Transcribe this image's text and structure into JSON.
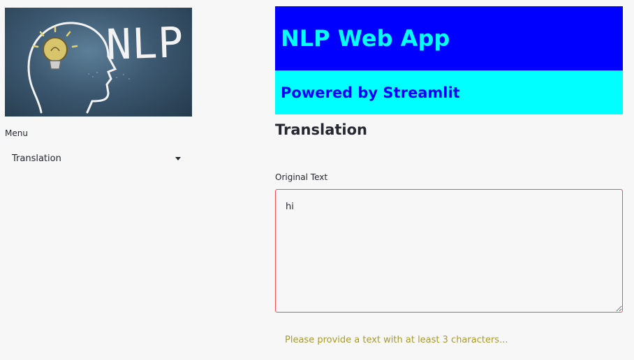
{
  "sidebar": {
    "logo_text": "NLP",
    "menu_label": "Menu",
    "menu_selected": "Translation"
  },
  "main": {
    "title": "NLP Web App",
    "subtitle": "Powered by Streamlit",
    "section_title": "Translation",
    "input_label": "Original Text",
    "input_value": "hi",
    "warning": "Please provide a text with at least 3 characters..."
  },
  "colors": {
    "title_bg": "#0000ff",
    "title_fg": "#00ffff",
    "subtitle_bg": "#00ffff",
    "subtitle_fg": "#0000ff",
    "error_border": "#ff4b4b",
    "warning_text": "#a89a2c"
  }
}
